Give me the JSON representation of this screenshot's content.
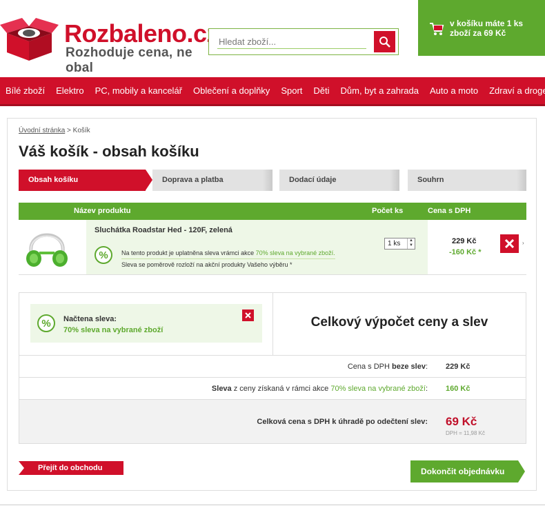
{
  "header": {
    "logo_name": "Rozbaleno",
    "logo_tld": ".cz",
    "logo_slogan": "Rozhoduje cena, ne obal",
    "search_placeholder": "Hledat zboží...",
    "cart_text": "v košíku máte 1 ks zboží za 69 Kč"
  },
  "nav": {
    "items": [
      "Bílé zboží",
      "Elektro",
      "PC, mobily a kancelář",
      "Oblečení a doplňky",
      "Sport",
      "Děti",
      "Dům, byt a zahrada",
      "Auto a moto",
      "Zdraví a drogerie"
    ]
  },
  "breadcrumb": {
    "home": "Úvodní stránka",
    "sep": " > ",
    "current": "Košík"
  },
  "page_title": "Váš košík - obsah košíku",
  "steps": [
    "Obsah košíku",
    "Doprava a platba",
    "Dodací údaje",
    "Souhrn"
  ],
  "table": {
    "col_name": "Název produktu",
    "col_qty": "Počet ks",
    "col_price": "Cena s DPH"
  },
  "product": {
    "name": "Sluchátka Roadstar Hed - 120F, zelená",
    "promo_pre": "Na tento produkt je uplatněna sleva vrámci akce ",
    "promo_link": "70% sleva na vybrané zboží.",
    "promo_line2": "Sleva se poměrově rozloží na akční produkty Vašeho výběru *",
    "qty": "1 ks",
    "price": "229 Kč",
    "discount": "-160 Kč *",
    "pct_symbol": "%"
  },
  "summary": {
    "loaded_label": "Načtena sleva:",
    "loaded_value": "70% sleva na vybrané zboží",
    "title": "Celkový výpočet ceny a slev",
    "row1_pre": "Cena s DPH ",
    "row1_bold": "beze slev",
    "row1_post": ":",
    "row1_value": "229 Kč",
    "row2_bold": "Sleva",
    "row2_pre": " z ceny získaná v rámci akce ",
    "row2_link": "70% sleva na vybrané zboží",
    "row2_post": ":",
    "row2_value": "160 Kč",
    "row3_label": "Celková cena s DPH k úhradě po odečtení slev:",
    "row3_value": "69 Kč",
    "vat": "DPH = 11,98 Kč"
  },
  "buttons": {
    "back": "Přejít do obchodu",
    "finish": "Dokončit objednávku"
  },
  "colors": {
    "brand_red": "#d0102a",
    "brand_green": "#5ea92e"
  }
}
